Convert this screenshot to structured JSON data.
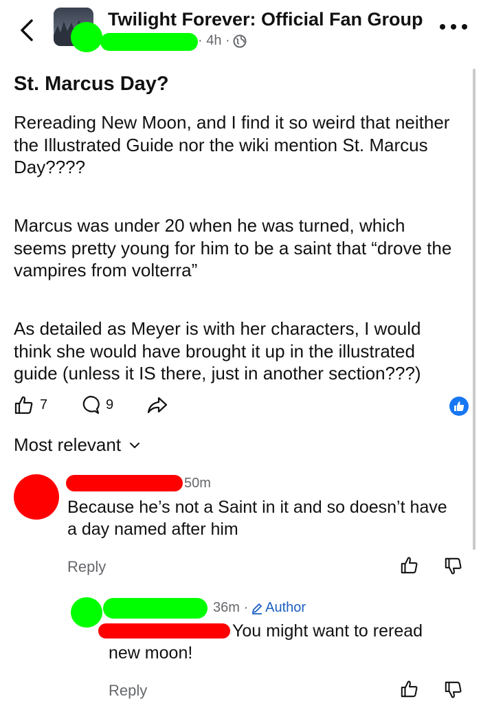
{
  "header": {
    "group_name": "Twilight Forever: Official Fan Group",
    "post_meta": "· 4h ·"
  },
  "post": {
    "title": "St. Marcus Day?",
    "paragraphs": [
      "Rereading New Moon, and I find it so weird that neither the Illustrated Guide nor the wiki mention St. Marcus Day????",
      "Marcus was under 20 when he was turned, which seems pretty young for him to be a saint that “drove the vampires from volterra”",
      "As detailed as Meyer is with her characters, I would think she would have brought it up in the illustrated guide (unless it IS there, just in another section???)"
    ],
    "like_count": "7",
    "comment_count": "9"
  },
  "sort": {
    "label": "Most relevant"
  },
  "comments": [
    {
      "time": "50m",
      "text": "Because he’s not a Saint in it and so doesn’t have a day named after him",
      "reply_label": "Reply"
    },
    {
      "time": "36m ·",
      "author_label": "Author",
      "text": "You might want to reread",
      "text_line2": "new moon!",
      "reply_label": "Reply"
    }
  ],
  "colors": {
    "accent": "#1877f2",
    "secondary_text": "#65676b",
    "author_badge": "#1b5fc2",
    "redaction_green": "#00ff00",
    "redaction_red": "#ff0000"
  },
  "icons": [
    "back-chevron-icon",
    "globe-icon",
    "more-icon",
    "thumbs-up-icon",
    "comment-bubble-icon",
    "share-arrow-icon",
    "like-reaction-icon",
    "chevron-down-icon",
    "pencil-icon",
    "thumbs-down-icon"
  ]
}
